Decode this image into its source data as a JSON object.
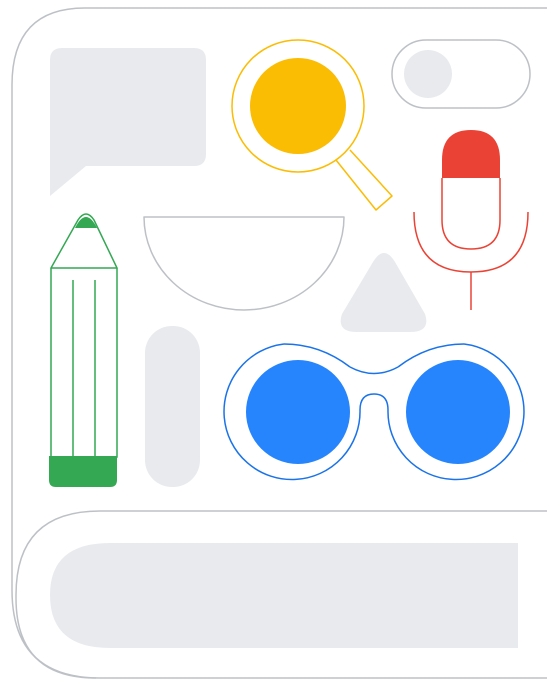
{
  "colors": {
    "background": "#ffffff",
    "outline_gray": "#bdc1c6",
    "fill_gray": "#e8eaed",
    "google_yellow": "#fbbc04",
    "google_red": "#ea4335",
    "google_green": "#34a853",
    "google_blue": "#1a73e8",
    "google_blue_light": "#2684fc"
  },
  "shapes": [
    "device-frame-outline",
    "chat-bubble-icon",
    "magnifying-glass-icon",
    "toggle-switch-icon",
    "microphone-icon",
    "pencil-icon",
    "half-circle-bowl-shape",
    "triangle-shape",
    "pill-shape",
    "glasses-icon",
    "bottom-bar-shape"
  ]
}
